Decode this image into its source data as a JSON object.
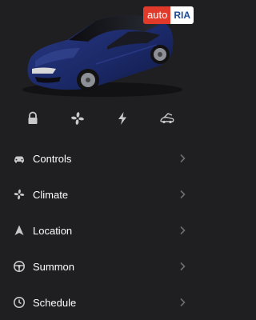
{
  "watermark": {
    "part1": "auto",
    "part2": "RIA"
  },
  "colors": {
    "background": "#1f1f21",
    "car_body": "#1d2c6e",
    "icon": "#c8c8c8",
    "chevron": "#6e6e72"
  },
  "quick_actions": [
    {
      "icon": "lock-icon"
    },
    {
      "icon": "fan-icon"
    },
    {
      "icon": "charge-bolt-icon"
    },
    {
      "icon": "frunk-icon"
    }
  ],
  "menu": [
    {
      "label": "Controls",
      "icon": "car-icon"
    },
    {
      "label": "Climate",
      "icon": "fan-icon"
    },
    {
      "label": "Location",
      "icon": "location-arrow-icon"
    },
    {
      "label": "Summon",
      "icon": "steering-wheel-icon"
    },
    {
      "label": "Schedule",
      "icon": "clock-icon"
    }
  ]
}
